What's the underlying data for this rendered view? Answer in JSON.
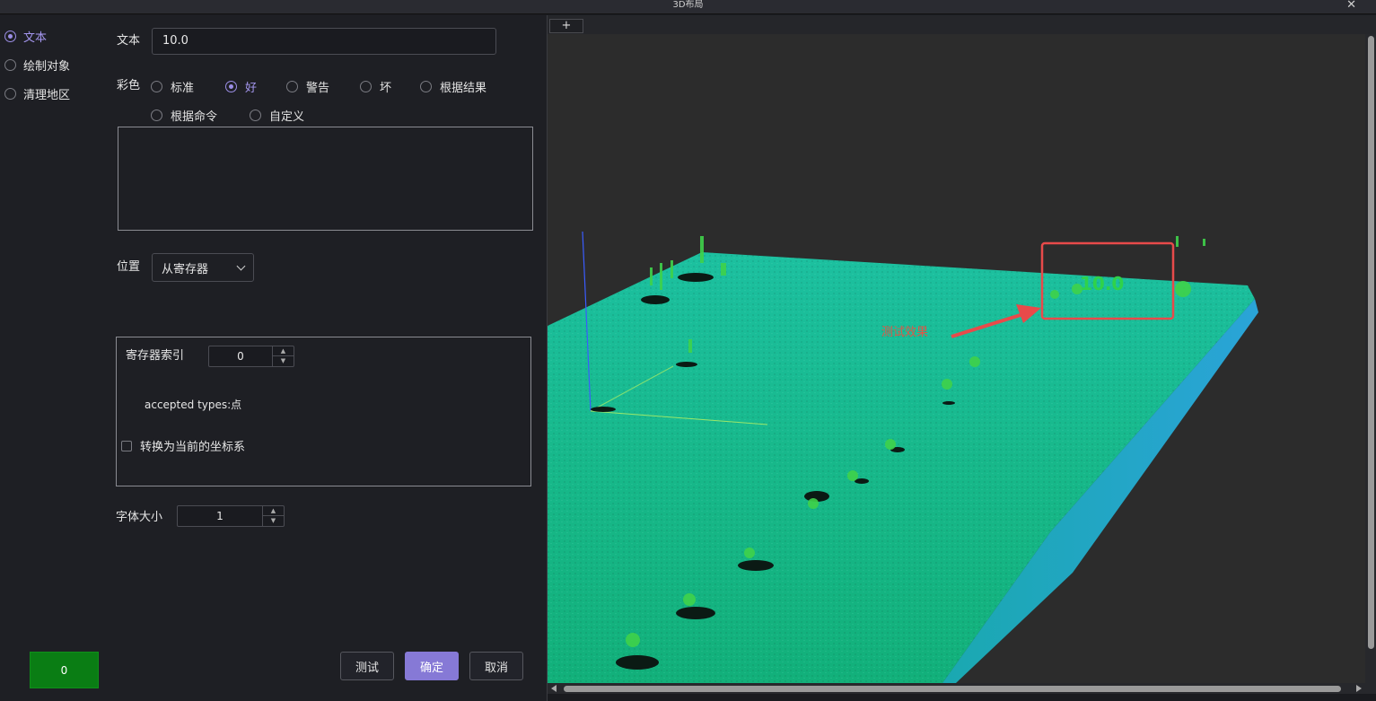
{
  "window": {
    "title": "3D布局",
    "close_glyph": "✕"
  },
  "mode": {
    "items": [
      {
        "label": "文本",
        "selected": true
      },
      {
        "label": "绘制对象",
        "selected": false
      },
      {
        "label": "清理地区",
        "selected": false
      }
    ]
  },
  "text_field": {
    "label": "文本",
    "value": "10.0"
  },
  "color": {
    "label": "彩色",
    "options": [
      {
        "label": "标准",
        "selected": false
      },
      {
        "label": "好",
        "selected": true
      },
      {
        "label": "警告",
        "selected": false
      },
      {
        "label": "坏",
        "selected": false
      },
      {
        "label": "根据结果",
        "selected": false
      },
      {
        "label": "根据命令",
        "selected": false
      },
      {
        "label": "自定义",
        "selected": false
      }
    ]
  },
  "position": {
    "label": "位置",
    "value": "从寄存器"
  },
  "register": {
    "index_label": "寄存器索引",
    "index_value": "0",
    "accepted_types": "accepted types:点",
    "convert_label": "转换为当前的坐标系",
    "convert_checked": false
  },
  "font_size": {
    "label": "字体大小",
    "value": "1"
  },
  "buttons": {
    "test": "测试",
    "ok": "确定",
    "cancel": "取消",
    "status": "0"
  },
  "viewer": {
    "tab_add": "+",
    "overlay_value": "10.0",
    "annotation": "测试效果",
    "point_color": "#1fbf8f",
    "highlight_color": "#e84a4a"
  },
  "accent_color": "#8679d6"
}
